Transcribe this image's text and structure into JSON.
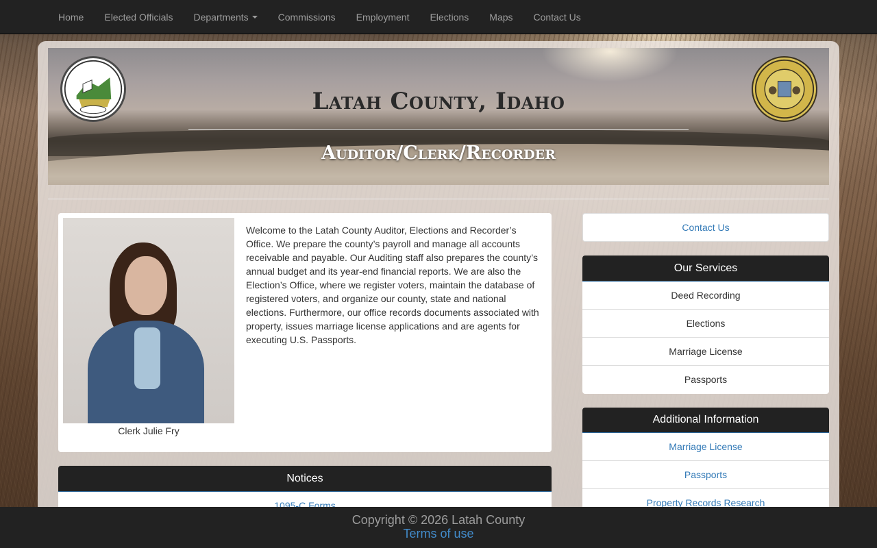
{
  "nav": {
    "items": [
      {
        "label": "Home"
      },
      {
        "label": "Elected Officials"
      },
      {
        "label": "Departments"
      },
      {
        "label": "Commissions"
      },
      {
        "label": "Employment"
      },
      {
        "label": "Elections"
      },
      {
        "label": "Maps"
      },
      {
        "label": "Contact Us"
      }
    ]
  },
  "banner": {
    "county_title": "Latah County, Idaho",
    "department_title": "Auditor/Clerk/Recorder",
    "seal_left_text": "LATAH COUNTY IDAHO 1888",
    "seal_right_text": "GREAT SEAL OF THE STATE OF IDAHO"
  },
  "welcome": {
    "photo_caption": "Clerk Julie Fry",
    "text": "Welcome to the Latah County Auditor, Elections and Recorder’s Office. We prepare the county’s payroll and manage all accounts receivable and payable. Our Auditing staff also prepares the county’s annual budget and its year-end financial reports. We are also the Election’s Office, where we register voters, maintain the database of registered voters, and organize our county, state and national elections. Furthermore, our office records documents associated with property, issues marriage license applications and are agents for executing U.S. Passports."
  },
  "notices": {
    "title": "Notices",
    "items": [
      {
        "label": "1095-C Forms"
      }
    ]
  },
  "sidebar": {
    "contact_label": "Contact Us",
    "services": {
      "title": "Our Services",
      "items": [
        {
          "label": "Deed Recording"
        },
        {
          "label": "Elections"
        },
        {
          "label": "Marriage License"
        },
        {
          "label": "Passports"
        }
      ]
    },
    "additional": {
      "title": "Additional Information",
      "items": [
        {
          "label": "Marriage License"
        },
        {
          "label": "Passports"
        },
        {
          "label": "Property Records Research"
        }
      ]
    }
  },
  "footer": {
    "copyright": "Copyright © 2026 Latah County",
    "terms": "Terms of use"
  }
}
